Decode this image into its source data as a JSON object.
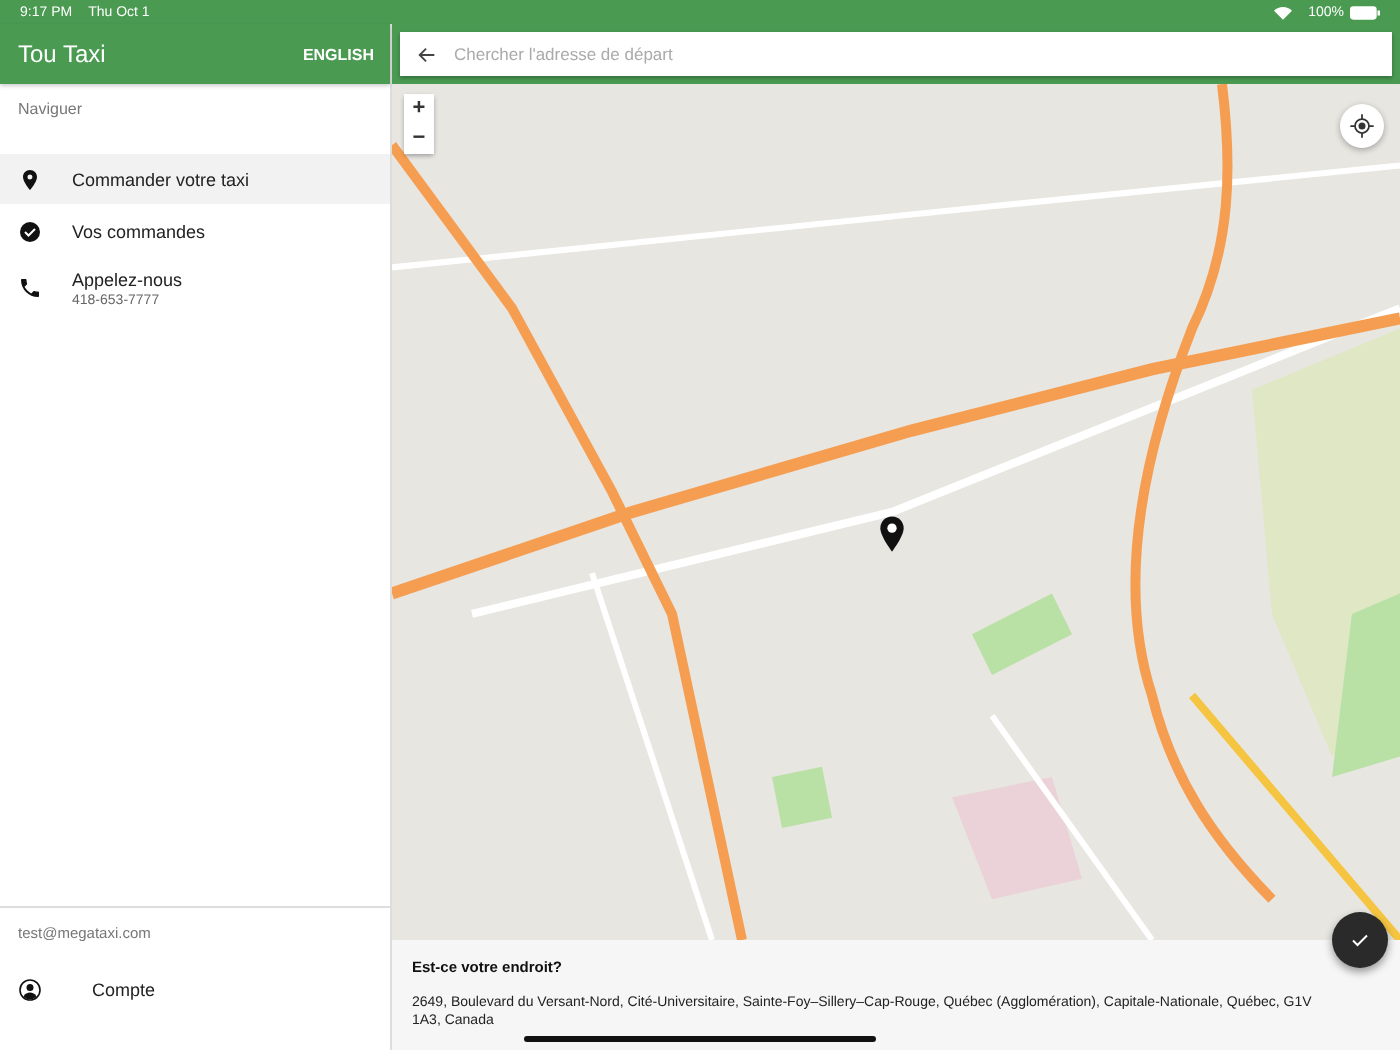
{
  "status_bar": {
    "time": "9:17 PM",
    "date": "Thu Oct 1",
    "battery": "100%"
  },
  "header": {
    "title": "Tou Taxi",
    "language_button": "ENGLISH"
  },
  "search": {
    "placeholder": "Chercher l'adresse de départ"
  },
  "nav": {
    "section": "Naviguer",
    "items": [
      {
        "kind": "pin",
        "label": "Commander votre taxi",
        "selected": true
      },
      {
        "kind": "check",
        "label": "Vos commandes",
        "selected": false
      },
      {
        "kind": "phone",
        "label": "Appelez-nous",
        "sublabel": "418-653-7777",
        "selected": false
      }
    ]
  },
  "account": {
    "email": "test@megataxi.com",
    "label": "Compte"
  },
  "map": {
    "zoom_in": "+",
    "zoom_out": "−"
  },
  "location_card": {
    "question": "Est-ce votre endroit?",
    "address": "2649, Boulevard du Versant-Nord, Cité-Universitaire, Sainte-Foy–Sillery–Cap-Rouge, Québec (Agglomération), Capitale-Nationale, Québec, G1V 1A3, Canada"
  }
}
